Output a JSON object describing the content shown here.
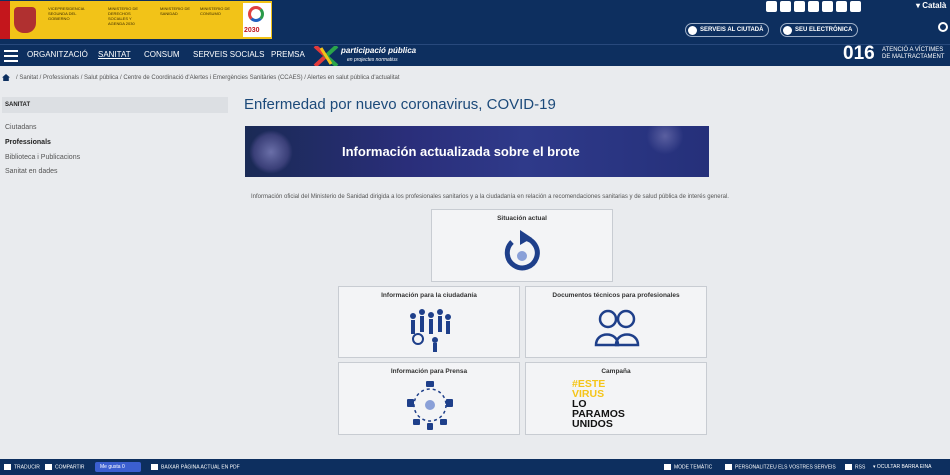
{
  "header": {
    "gov_line1": "VICEPRESIDENCIA SEGUNDA DEL GOBIERNO",
    "gov_line2": "MINISTERIO DE DERECHOS SOCIALES Y AGENDA 2030",
    "gov_line3": "MINISTERIO DE SANIDAD",
    "gov_line4": "MINISTERIO DE CONSUMO",
    "agenda_year": "2030",
    "language": "Català",
    "pills": [
      "SERVEIS AL CIUTADÀ",
      "SEU ELECTRÒNICA"
    ]
  },
  "nav": {
    "items": [
      "ORGANITZACIÓ",
      "SANITAT",
      "CONSUM",
      "SERVEIS SOCIALS",
      "PREMSA"
    ],
    "participation_title": "participació pública",
    "participation_sub": "en projectes normatius",
    "helpline_number": "016",
    "helpline_text_1": "ATENCIÓ A VÍCTIMES",
    "helpline_text_2": "DE MALTRACTAMENT"
  },
  "breadcrumb": "/ Sanitat / Professionals / Salut pública / Centre de Coordinació d'Alertes i Emergències Sanitàries (CCAES) / Alertes en salut pública d'actualitat",
  "sidebar": {
    "heading": "SANITAT",
    "items": [
      "Ciutadans",
      "Professionals",
      "Biblioteca i Publicacions",
      "Sanitat en dades"
    ],
    "current_index": 1
  },
  "main": {
    "title": "Enfermedad por nuevo coronavirus, COVID-19",
    "banner_text": "Información actualizada sobre el brote",
    "intro": "Información oficial del Ministerio de Sanidad dirigida a los profesionales sanitarios y a la ciudadanía en relación a recomendaciones sanitarias y de salud pública de interés general.",
    "cards": {
      "situacion": "Situación actual",
      "ciudadania": "Información para la ciudadanía",
      "documentos": "Documentos técnicos para profesionales",
      "prensa": "Información para Prensa",
      "campana": "Campaña"
    },
    "campaign_lines": [
      "#ESTE",
      "VIRUS",
      "LO",
      "PARAMOS",
      "UNIDOS"
    ]
  },
  "footer": {
    "items": [
      "TRADUCIR",
      "COMPARTIR",
      "Me gusta 0",
      "BAIXAR PÀGINA ACTUAL EN PDF",
      "MODE TEMÀTIC",
      "PERSONALITZEU ELS VOSTRES SERVEIS",
      "RSS",
      "OCULTAR BARRA EINA"
    ]
  },
  "colors": {
    "navy": "#0d2f5f",
    "gov_yellow": "#f2c318",
    "title_blue": "#1c4a7a",
    "icon_blue": "#1e3f8a",
    "campaign_yellow": "#f5c518"
  }
}
